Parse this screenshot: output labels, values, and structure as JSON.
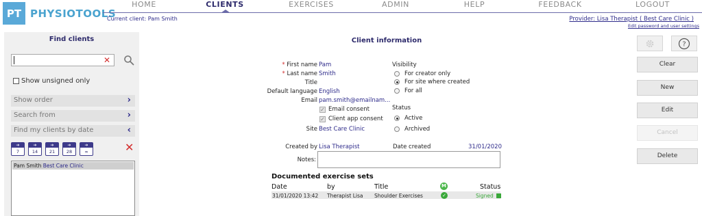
{
  "header": {
    "logo_mark": "PT",
    "app_name": "PHYSIOTOOLS",
    "nav": [
      "HOME",
      "CLIENTS",
      "EXERCISES",
      "ADMIN",
      "HELP",
      "FEEDBACK",
      "LOGOUT"
    ],
    "active_nav": "CLIENTS",
    "current_client": "Current client: Pam Smith",
    "provider": "Provider: Lisa Therapist ( Best Care Clinic )",
    "edit_settings": "Edit password and user settings"
  },
  "left": {
    "title": "Find clients",
    "search_value": "",
    "show_unsigned": "Show unsigned only",
    "show_order": "Show order",
    "search_from": "Search from",
    "find_by_date": "Find my clients by date",
    "date_buttons": [
      "7",
      "14",
      "21",
      "28",
      "∞"
    ],
    "clients": [
      {
        "name": "Pam Smith",
        "site": "Best Care Clinic"
      }
    ]
  },
  "client": {
    "title": "Client information",
    "first_name_label": "First name",
    "first_name": "Pam",
    "last_name_label": "Last name",
    "last_name": "Smith",
    "title_label": "Title",
    "language_label": "Default language",
    "language": "English",
    "email_label": "Email",
    "email": "pam.smith@emailnam...",
    "email_consent": "Email consent",
    "app_consent": "Client app consent",
    "site_label": "Site",
    "site": "Best Care Clinic",
    "visibility_label": "Visibility",
    "visibility_options": [
      "For creator only",
      "For site where created",
      "For all"
    ],
    "visibility_selected": 1,
    "status_label": "Status",
    "status_options": [
      "Active",
      "Archived"
    ],
    "status_selected": 0,
    "created_by_label": "Created by",
    "created_by": "Lisa Therapist",
    "date_created_label": "Date created",
    "date_created": "31/01/2020",
    "notes_label": "Notes:",
    "notes": ""
  },
  "exercise_sets": {
    "title": "Documented exercise sets",
    "columns": {
      "date": "Date",
      "by": "by",
      "title": "Title",
      "m": "M",
      "status": "Status"
    },
    "rows": [
      {
        "date": "31/01/2020 13:42",
        "by": "Therapist Lisa",
        "title": "Shoulder Exercises",
        "status": "Signed"
      }
    ]
  },
  "actions": {
    "clear": "Clear",
    "new": "New",
    "edit": "Edit",
    "cancel": "Cancel",
    "delete": "Delete"
  }
}
